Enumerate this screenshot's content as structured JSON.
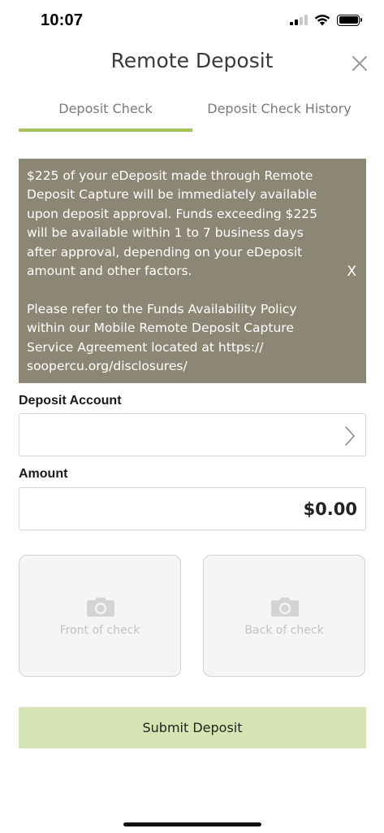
{
  "status_bar": {
    "time": "10:07",
    "signal_icon": "cellular-signal-icon",
    "wifi_icon": "wifi-icon",
    "battery_icon": "battery-icon"
  },
  "header": {
    "title": "Remote Deposit",
    "close_icon": "close-icon"
  },
  "tabs": [
    {
      "label": "Deposit Check",
      "active": true
    },
    {
      "label": "Deposit Check History",
      "active": false
    }
  ],
  "notice": {
    "paragraph_1": "$225 of your eDeposit made through Remote Deposit Capture will be immediately available upon deposit approval. Funds exceeding $225 will be available within 1 to 7 business days after approval, depending on your eDeposit amount and other factors.",
    "paragraph_2": "Please refer to the Funds Availability Policy within our Mobile Remote Deposit Capture Service Agreement located at https:// soopercu.org/disclosures/",
    "close_label": "X",
    "background_color": "#8c8675"
  },
  "deposit_account": {
    "label": "Deposit Account",
    "value": "",
    "chevron_icon": "chevron-right-icon"
  },
  "amount": {
    "label": "Amount",
    "value": "$0.00"
  },
  "check_images": {
    "front_label": "Front of check",
    "back_label": "Back of check",
    "camera_icon": "camera-icon"
  },
  "submit": {
    "label": "Submit Deposit",
    "color": "#d6e4b4"
  },
  "accent_color": "#a4c25a"
}
